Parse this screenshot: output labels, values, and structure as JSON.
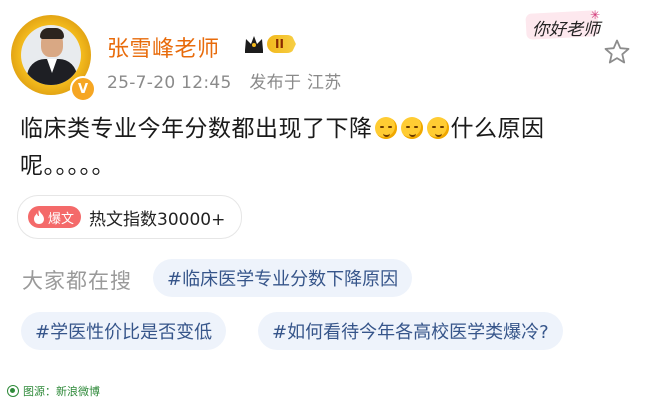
{
  "post": {
    "author": "张雪峰老师",
    "level": "II",
    "time": "25-7-20 12:45",
    "source": "发布于 江苏",
    "verified_mark": "V",
    "text_line1_a": "临床类专业今年分数都出现了下降",
    "text_line1_b": "什么原因",
    "text_line2": "呢。。。。。",
    "emoji_name": "thinking-face-icon"
  },
  "sticker": {
    "text": "你好老师"
  },
  "hot": {
    "badge": "爆文",
    "text": "热文指数30000+"
  },
  "search": {
    "label": "大家都在搜",
    "tags": [
      "#临床医学专业分数下降原因",
      "#学医性价比是否变低",
      "#如何看待今年各高校医学类爆冷?"
    ]
  },
  "credit": {
    "text": "图源：新浪微博"
  },
  "colors": {
    "author": "#e86b0b",
    "tag_bg": "#eef3fb",
    "tag_text": "#36558a",
    "hot_badge": "#f46a6a"
  }
}
